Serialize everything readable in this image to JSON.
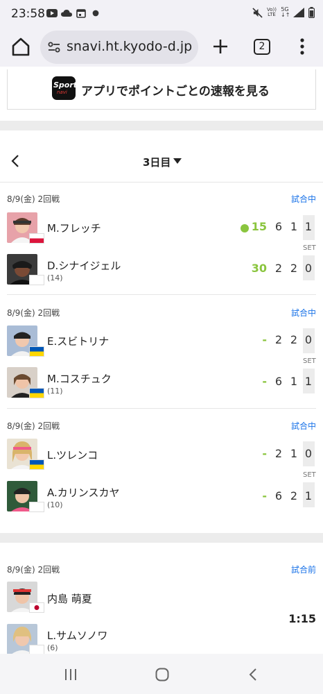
{
  "status_bar": {
    "time": "23:58",
    "left_icons": [
      "youtube-icon",
      "cloud-icon",
      "calendar-icon",
      "dot-icon"
    ],
    "right_icons": [
      "mute-icon",
      "volte-icon",
      "5g-icon",
      "signal-icon",
      "battery-icon"
    ],
    "volte_label": "VoLTE",
    "net_label": "5G"
  },
  "browser": {
    "url": "snavi.ht.kyodo-d.jp",
    "tab_count": "2"
  },
  "banner": {
    "logo_top": "Sports",
    "logo_bottom": "navi",
    "text": "アプリでポイントごとの速報を見る"
  },
  "day_selector": {
    "label": "3日目"
  },
  "colors": {
    "live_green": "#8ac53e",
    "status_blue": "#1a73e8"
  },
  "matches": [
    {
      "date": "8/9(金) 2回戦",
      "status": "試合中",
      "set_label": "SET",
      "players": [
        {
          "name": "M.フレッチ",
          "seed": "",
          "flag": "poland",
          "points": "15",
          "serving": true,
          "sets": [
            "6",
            "1",
            "1"
          ]
        },
        {
          "name": "D.シナイジェル",
          "seed": "(14)",
          "flag": "neutral",
          "points": "30",
          "serving": false,
          "sets": [
            "2",
            "2",
            "0"
          ]
        }
      ]
    },
    {
      "date": "8/9(金) 2回戦",
      "status": "試合中",
      "set_label": "SET",
      "players": [
        {
          "name": "E.スビトリナ",
          "seed": "",
          "flag": "ukraine",
          "points": "-",
          "serving": false,
          "sets": [
            "2",
            "2",
            "0"
          ]
        },
        {
          "name": "M.コスチュク",
          "seed": "(11)",
          "flag": "ukraine",
          "points": "-",
          "serving": false,
          "sets": [
            "6",
            "1",
            "1"
          ]
        }
      ]
    },
    {
      "date": "8/9(金) 2回戦",
      "status": "試合中",
      "set_label": "SET",
      "players": [
        {
          "name": "L.ツレンコ",
          "seed": "",
          "flag": "ukraine",
          "points": "-",
          "serving": false,
          "sets": [
            "2",
            "1",
            "0"
          ]
        },
        {
          "name": "A.カリンスカヤ",
          "seed": "(10)",
          "flag": "neutral",
          "points": "-",
          "serving": false,
          "sets": [
            "6",
            "2",
            "1"
          ]
        }
      ]
    },
    {
      "date": "8/9(金) 2回戦",
      "status": "試合前",
      "start_time": "1:15",
      "players": [
        {
          "name": "内島 萌夏",
          "seed": "",
          "flag": "japan"
        },
        {
          "name": "L.サムソノワ",
          "seed": "(6)",
          "flag": "neutral"
        }
      ]
    }
  ]
}
